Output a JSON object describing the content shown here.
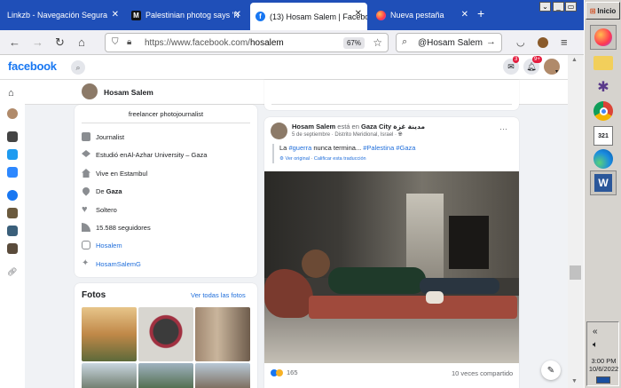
{
  "browser": {
    "tabs": [
      {
        "label": "Linkzb - Navegación Segura",
        "active": false
      },
      {
        "label": "Palestinian photog says 'N",
        "active": false
      },
      {
        "label": "(13) Hosam Salem | Facebo",
        "active": true
      },
      {
        "label": "Nueva pestaña",
        "active": false
      }
    ],
    "new_tab": "+",
    "url_prefix": "https://www.facebook.com/",
    "url_path": "hosalem",
    "zoom": "67%",
    "search_text": "@Hosam Salem"
  },
  "window": {
    "minimize": "_",
    "restore": "▭",
    "close": "✕",
    "list": "⌄"
  },
  "facebook": {
    "logo": "facebook",
    "messenger_badge": "3",
    "notif_badge": "9+",
    "profile_name": "Hosam Salem",
    "more": "···",
    "intro": {
      "bio": "freelancer photojournalist",
      "rows": [
        {
          "icon": "briefcase-icon",
          "pre": "",
          "link": "",
          "text": "Journalist"
        },
        {
          "icon": "graduation-cap-icon",
          "pre": "Estudió en ",
          "link": "",
          "text": "Al-Azhar University – Gaza"
        },
        {
          "icon": "home-icon",
          "pre": "Vive en ",
          "link": "",
          "text": "Estambul"
        },
        {
          "icon": "location-pin-icon",
          "pre": "De ",
          "link": "",
          "text": "Gaza"
        },
        {
          "icon": "heart-icon",
          "pre": "",
          "link": "",
          "text": "Soltero"
        },
        {
          "icon": "rss-icon",
          "pre": "",
          "link": "",
          "text": "15.588 seguidores"
        },
        {
          "icon": "instagram-icon",
          "pre": "",
          "link": "Hosalem",
          "text": ""
        },
        {
          "icon": "twitter-icon",
          "pre": "",
          "link": "HosamSalemG",
          "text": ""
        }
      ]
    },
    "photos": {
      "title": "Fotos",
      "see_all": "Ver todas las fotos"
    },
    "post": {
      "author": "Hosam Salem",
      "est_en": " está en ",
      "place": "Gaza City",
      "place_ar": "مدينة غزة",
      "date": "5 de septiembre · Distrito Meridional, Israel · ",
      "text_pre": "La ",
      "hashtag1": "#guerra",
      "text_mid": " nunca termina... ",
      "hashtag2": "#Palestina",
      "hashtag3": "#Gaza",
      "translate_original": "Ver original",
      "translate_sep": " · ",
      "translate_rate": "Calificar esta traducción",
      "reactions": "165",
      "shares": "10 veces compartido"
    }
  },
  "taskbar": {
    "start": "Inicio",
    "time": "3:00 PM",
    "date": "10/6/2022",
    "chevron": "«"
  },
  "colors": {
    "fb_blue": "#1877f2",
    "tab_bar": "#1f4fb8",
    "link": "#216fdb"
  }
}
